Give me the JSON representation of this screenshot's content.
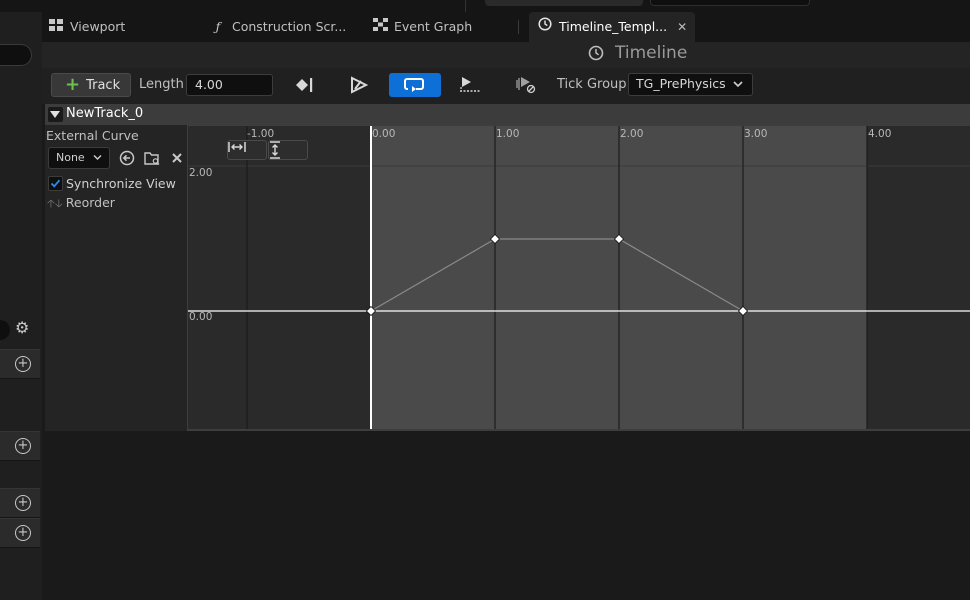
{
  "tabs": [
    {
      "label": "Viewport",
      "icon": "viewport-icon"
    },
    {
      "label": "Construction Scr...",
      "icon": "function-icon"
    },
    {
      "label": "Event Graph",
      "icon": "event-graph-icon"
    },
    {
      "label": "Timeline_Templ...",
      "icon": "clock-icon",
      "active": true
    }
  ],
  "panel_title": "Timeline",
  "toolbar": {
    "track_label": "Track",
    "length_label": "Length",
    "length_value": "4.00",
    "tick_group_label": "Tick Group",
    "tick_group_value": "TG_PrePhysics"
  },
  "track": {
    "name": "NewTrack_0",
    "external_curve_label": "External Curve",
    "external_curve_value": "None",
    "sync_view_label": "Synchronize View",
    "sync_view_checked": true,
    "reorder_label": "Reorder"
  },
  "graph": {
    "time_ticks": [
      "-1.00",
      "0.00",
      "1.00",
      "2.00",
      "3.00",
      "4.00"
    ],
    "value_labels": [
      "2.00",
      "0.00"
    ],
    "length": 4.0,
    "keys": [
      {
        "time": 0.0,
        "value": 0.0
      },
      {
        "time": 1.0,
        "value": 1.0
      },
      {
        "time": 2.0,
        "value": 1.0
      },
      {
        "time": 3.0,
        "value": 0.0
      }
    ]
  },
  "colors": {
    "accent": "#0e6fd6",
    "add": "#6cc24a",
    "range_fill": "#4a4a4a"
  }
}
